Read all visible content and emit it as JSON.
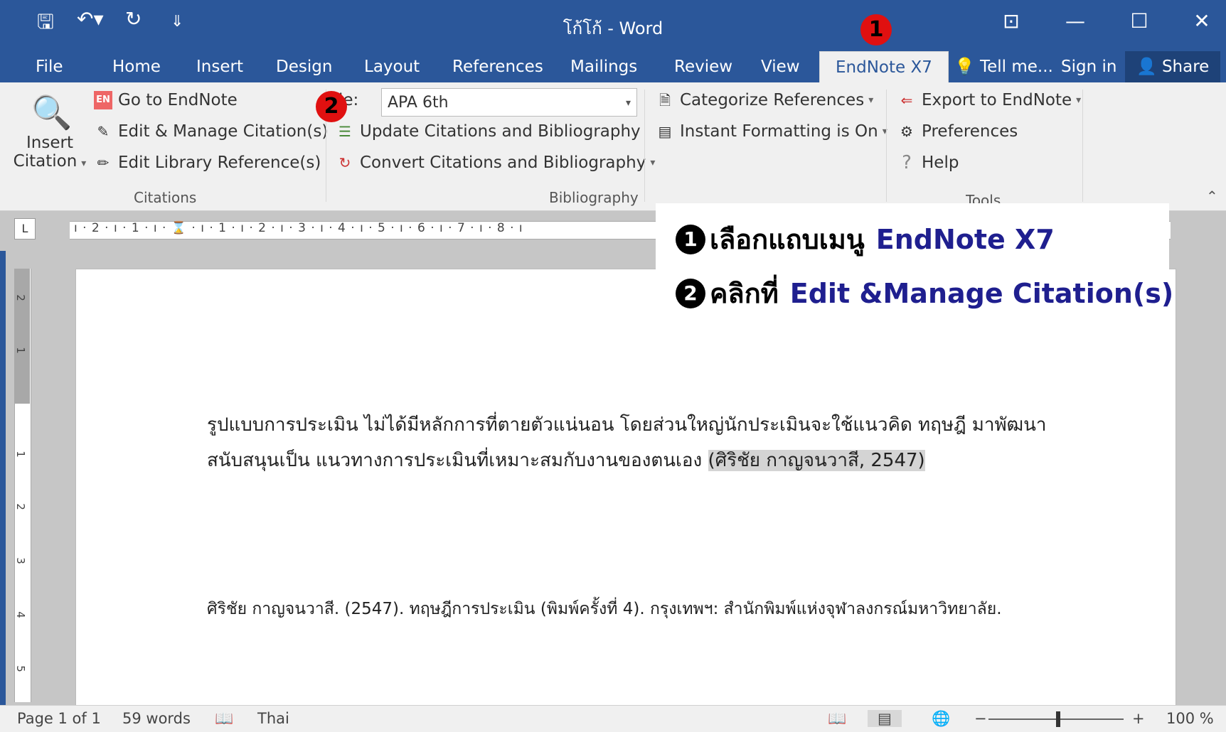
{
  "titlebar": {
    "doc_title": "โก้โก้ - Word",
    "qa_save": "🖫",
    "qa_undo": "↶▾",
    "qa_redo": "↻",
    "qa_more": "⇓",
    "win_ribbon": "⊡",
    "win_minimize": "—",
    "win_maximize": "☐",
    "win_close": "✕"
  },
  "tabs": {
    "file": "File",
    "home": "Home",
    "insert": "Insert",
    "design": "Design",
    "layout": "Layout",
    "references": "References",
    "mailings": "Mailings",
    "review": "Review",
    "view": "View",
    "endnote": "EndNote X7",
    "tell_me": "Tell me...",
    "sign_in": "Sign in",
    "share": "Share"
  },
  "ribbon": {
    "insert_citation_1": "Insert",
    "insert_citation_2": "Citation",
    "go_to_endnote": "Go to EndNote",
    "edit_manage": "Edit & Manage Citation(s)",
    "edit_library": "Edit Library Reference(s)",
    "citations_group": "Citations",
    "style_label": "le:",
    "style_value": "APA 6th",
    "update_citations": "Update Citations and Bibliography",
    "convert_citations": "Convert Citations and Bibliography",
    "bibliography_group": "Bibliography",
    "categorize": "Categorize References",
    "instant_formatting": "Instant Formatting is On",
    "export_endnote": "Export to EndNote",
    "preferences": "Preferences",
    "help": "Help",
    "tools_group": "Tools"
  },
  "ruler": {
    "corner": "L",
    "marks": "ı · 2 · ı · 1 · ı · ⌛ · ı · 1 · ı · 2 · ı · 3 · ı · 4 · ı · 5 · ı · 6 · ı · 7 · ı · 8 · ı"
  },
  "vruler": {
    "n2a": "2",
    "n1a": "1",
    "n1b": "1",
    "n2b": "2",
    "n3": "3",
    "n4": "4",
    "n5": "5"
  },
  "document": {
    "para_line1": "รูปแบบการประเมิน ไม่ได้มีหลักการที่ตายตัวแน่นอน โดยส่วนใหญ่นักประเมินจะใช้แนวคิด ทฤษฎี มาพัฒนา",
    "para_line2_pre": "สนับสนุนเป็น แนวทางการประเมินที่เหมาะสมกับงานของตนเอง ",
    "citation": "(ศิริชัย กาญจนวาสี, 2547)",
    "bibliography": "ศิริชัย กาญจนวาสี. (2547). ทฤษฎีการประเมิน (พิมพ์ครั้งที่ 4). กรุงเทพฯ: สำนักพิมพ์แห่งจุฬาลงกรณ์มหาวิทยาลัย."
  },
  "callout": {
    "num1": "1",
    "line1": "เลือกแถบเมนู",
    "line1_hi": "EndNote X7",
    "num2": "2",
    "line2": "คลิกที่",
    "line2_hi": "Edit &Manage Citation(s)"
  },
  "markers": {
    "m1": "1",
    "m2": "2"
  },
  "status": {
    "page": "Page 1 of 1",
    "words": "59 words",
    "language": "Thai",
    "zoom": "100 %"
  },
  "colors": {
    "accent": "#2b579a",
    "marker": "#e01010",
    "callout_highlight": "#1f1f8f"
  }
}
